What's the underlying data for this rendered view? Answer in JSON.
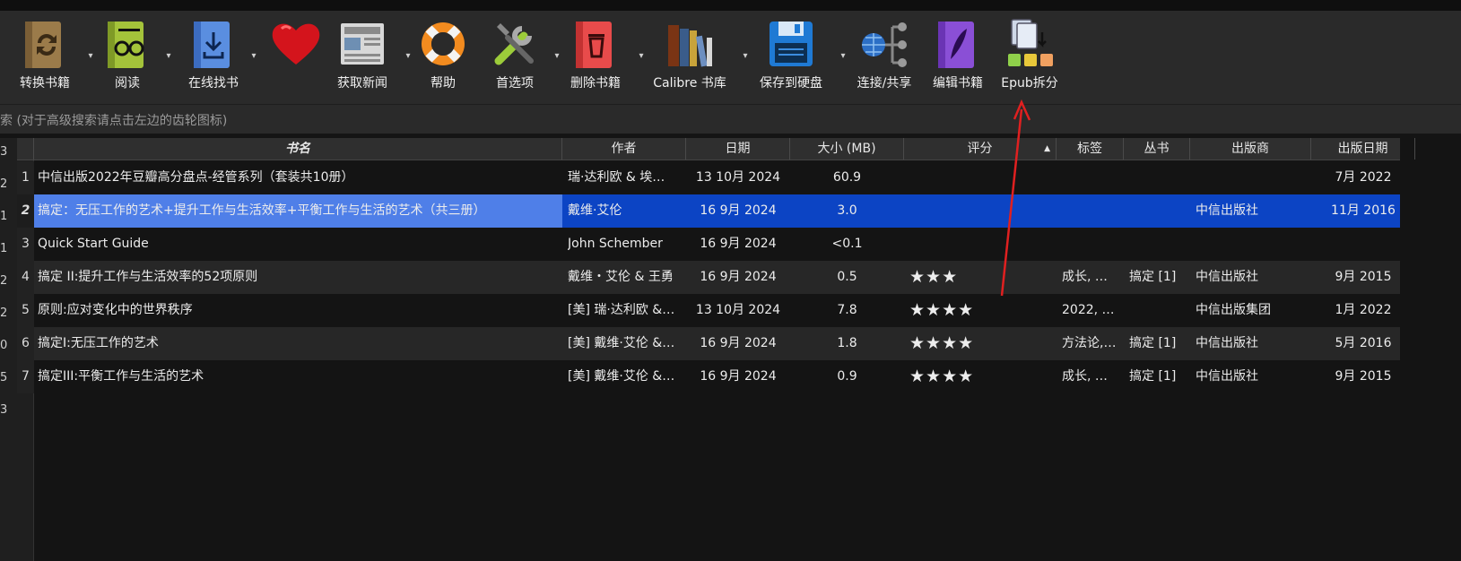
{
  "toolbar": {
    "buttons": [
      {
        "label": "转换书籍",
        "icon": "convert-book-icon"
      },
      {
        "label": "阅读",
        "icon": "read-book-icon"
      },
      {
        "label": "在线找书",
        "icon": "download-book-icon"
      },
      {
        "label": "",
        "icon": "heart-icon"
      },
      {
        "label": "获取新闻",
        "icon": "newspaper-icon"
      },
      {
        "label": "帮助",
        "icon": "lifebuoy-icon"
      },
      {
        "label": "首选项",
        "icon": "tools-icon"
      },
      {
        "label": "删除书籍",
        "icon": "trash-book-icon"
      },
      {
        "label": "Calibre 书库",
        "icon": "library-books-icon"
      },
      {
        "label": "保存到硬盘",
        "icon": "floppy-disk-icon"
      },
      {
        "label": "连接/共享",
        "icon": "network-share-icon"
      },
      {
        "label": "编辑书籍",
        "icon": "edit-book-icon"
      },
      {
        "label": "Epub拆分",
        "icon": "epub-split-icon"
      }
    ]
  },
  "search": {
    "placeholder": "索 (对于高级搜索请点击左边的齿轮图标)"
  },
  "gutter_numbers": [
    "3",
    "2",
    "1",
    "1",
    "2",
    "2",
    "0",
    "5",
    "3"
  ],
  "table": {
    "columns": [
      "书名",
      "作者",
      "日期",
      "大小 (MB)",
      "评分",
      "标签",
      "丛书",
      "出版商",
      "出版日期"
    ],
    "sort_indicator": "▲",
    "rows": [
      {
        "n": "1",
        "title": "中信出版2022年豆瓣高分盘点-经管系列（套装共10册）",
        "author": "瑞·达利欧 & 埃…",
        "date": "13 10月 2024",
        "size": "60.9",
        "rating": "",
        "tags": "",
        "series": "",
        "publisher": "",
        "pubdate": "7月 2022"
      },
      {
        "n": "2",
        "title": "搞定：无压工作的艺术+提升工作与生活效率+平衡工作与生活的艺术（共三册）",
        "author": "戴维·艾伦",
        "date": "16 9月 2024",
        "size": "3.0",
        "rating": "",
        "tags": "",
        "series": "",
        "publisher": "中信出版社",
        "pubdate": "11月 2016"
      },
      {
        "n": "3",
        "title": "Quick Start Guide",
        "author": "John Schember",
        "date": "16 9月 2024",
        "size": "<0.1",
        "rating": "",
        "tags": "",
        "series": "",
        "publisher": "",
        "pubdate": ""
      },
      {
        "n": "4",
        "title": "搞定 II:提升工作与生活效率的52项原则",
        "author": "戴维・艾伦 & 王勇",
        "date": "16 9月 2024",
        "size": "0.5",
        "rating": "★★★",
        "tags": "成长, …",
        "series": "搞定 [1]",
        "publisher": "中信出版社",
        "pubdate": "9月 2015"
      },
      {
        "n": "5",
        "title": "原则:应对变化中的世界秩序",
        "author": "[美] 瑞·达利欧 &…",
        "date": "13 10月 2024",
        "size": "7.8",
        "rating": "★★★★",
        "tags": "2022, …",
        "series": "",
        "publisher": "中信出版集团",
        "pubdate": "1月 2022"
      },
      {
        "n": "6",
        "title": "搞定I:无压工作的艺术",
        "author": "[美] 戴维·艾伦 &…",
        "date": "16 9月 2024",
        "size": "1.8",
        "rating": "★★★★",
        "tags": "方法论,…",
        "series": "搞定 [1]",
        "publisher": "中信出版社",
        "pubdate": "5月 2016"
      },
      {
        "n": "7",
        "title": "搞定III:平衡工作与生活的艺术",
        "author": "[美] 戴维·艾伦 &…",
        "date": "16 9月 2024",
        "size": "0.9",
        "rating": "★★★★",
        "tags": "成长, …",
        "series": "搞定 [1]",
        "publisher": "中信出版社",
        "pubdate": "9月 2015"
      }
    ]
  }
}
